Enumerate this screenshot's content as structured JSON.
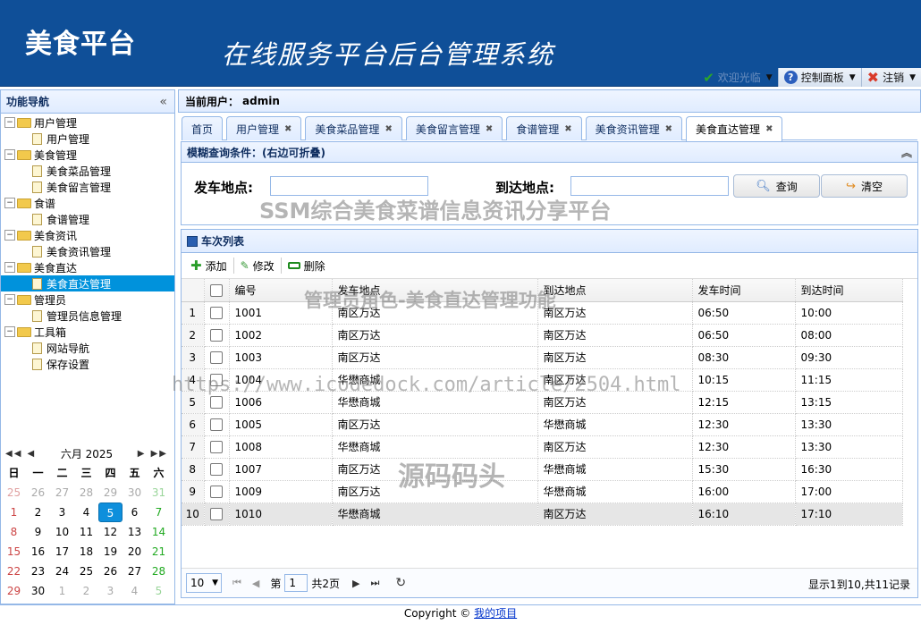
{
  "header": {
    "brand": "美食平台",
    "system_title": "在线服务平台后台管理系统",
    "welcome": "欢迎光临",
    "control_panel": "控制面板",
    "logout": "注销"
  },
  "sidebar": {
    "title": "功能导航",
    "groups": [
      {
        "label": "用户管理",
        "items": [
          "用户管理"
        ]
      },
      {
        "label": "美食管理",
        "items": [
          "美食菜品管理",
          "美食留言管理"
        ]
      },
      {
        "label": "食谱",
        "items": [
          "食谱管理"
        ]
      },
      {
        "label": "美食资讯",
        "items": [
          "美食资讯管理"
        ]
      },
      {
        "label": "美食直达",
        "items": [
          "美食直达管理"
        ]
      },
      {
        "label": "管理员",
        "items": [
          "管理员信息管理"
        ]
      },
      {
        "label": "工具箱",
        "items": [
          "网站导航",
          "保存设置"
        ]
      }
    ],
    "selected": "美食直达管理"
  },
  "calendar": {
    "title": "六月 2025",
    "weekdays": [
      "日",
      "一",
      "二",
      "三",
      "四",
      "五",
      "六"
    ],
    "days": [
      "25",
      "26",
      "27",
      "28",
      "29",
      "30",
      "31",
      "1",
      "2",
      "3",
      "4",
      "5",
      "6",
      "7",
      "8",
      "9",
      "10",
      "11",
      "12",
      "13",
      "14",
      "15",
      "16",
      "17",
      "18",
      "19",
      "20",
      "21",
      "22",
      "23",
      "24",
      "25",
      "26",
      "27",
      "28",
      "29",
      "30",
      "1",
      "2",
      "3",
      "4",
      "5"
    ],
    "today": "5"
  },
  "main": {
    "current_user_label": "当前用户：",
    "current_user": "admin",
    "tabs": [
      "首页",
      "用户管理",
      "美食菜品管理",
      "美食留言管理",
      "食谱管理",
      "美食资讯管理",
      "美食直达管理"
    ],
    "active_tab": "美食直达管理"
  },
  "query": {
    "title": "模糊查询条件：(右边可折叠)",
    "depart_label": "发车地点:",
    "arrive_label": "到达地点:",
    "search_button": "查询",
    "clear_button": "清空"
  },
  "grid": {
    "title": "车次列表",
    "add": "添加",
    "edit": "修改",
    "delete": "删除",
    "columns": [
      "编号",
      "发车地点",
      "到达地点",
      "发车时间",
      "到达时间"
    ],
    "rows": [
      {
        "n": "1",
        "id": "1001",
        "from": "南区万达",
        "to": "南区万达",
        "dep": "06:50",
        "arr": "10:00"
      },
      {
        "n": "2",
        "id": "1002",
        "from": "南区万达",
        "to": "南区万达",
        "dep": "06:50",
        "arr": "08:00"
      },
      {
        "n": "3",
        "id": "1003",
        "from": "南区万达",
        "to": "南区万达",
        "dep": "08:30",
        "arr": "09:30"
      },
      {
        "n": "4",
        "id": "1004",
        "from": "华懋商城",
        "to": "南区万达",
        "dep": "10:15",
        "arr": "11:15"
      },
      {
        "n": "5",
        "id": "1006",
        "from": "华懋商城",
        "to": "南区万达",
        "dep": "12:15",
        "arr": "13:15"
      },
      {
        "n": "6",
        "id": "1005",
        "from": "南区万达",
        "to": "华懋商城",
        "dep": "12:30",
        "arr": "13:30"
      },
      {
        "n": "7",
        "id": "1008",
        "from": "华懋商城",
        "to": "南区万达",
        "dep": "12:30",
        "arr": "13:30"
      },
      {
        "n": "8",
        "id": "1007",
        "from": "南区万达",
        "to": "华懋商城",
        "dep": "15:30",
        "arr": "16:30"
      },
      {
        "n": "9",
        "id": "1009",
        "from": "南区万达",
        "to": "华懋商城",
        "dep": "16:00",
        "arr": "17:00"
      },
      {
        "n": "10",
        "id": "1010",
        "from": "华懋商城",
        "to": "南区万达",
        "dep": "16:10",
        "arr": "17:10"
      }
    ]
  },
  "pager": {
    "page_size": "10",
    "page_label": "第",
    "page": "1",
    "total_pages": "共2页",
    "info": "显示1到10,共11记录"
  },
  "footer": {
    "copyright": "Copyright ©",
    "link": "我的项目"
  },
  "watermarks": {
    "line1": "SSM综合美食菜谱信息资讯分享平台",
    "line2": "管理员角色-美食直达管理功能",
    "line3": "https://www.icodedock.com/article/2504.html",
    "line4": "源码码头"
  }
}
